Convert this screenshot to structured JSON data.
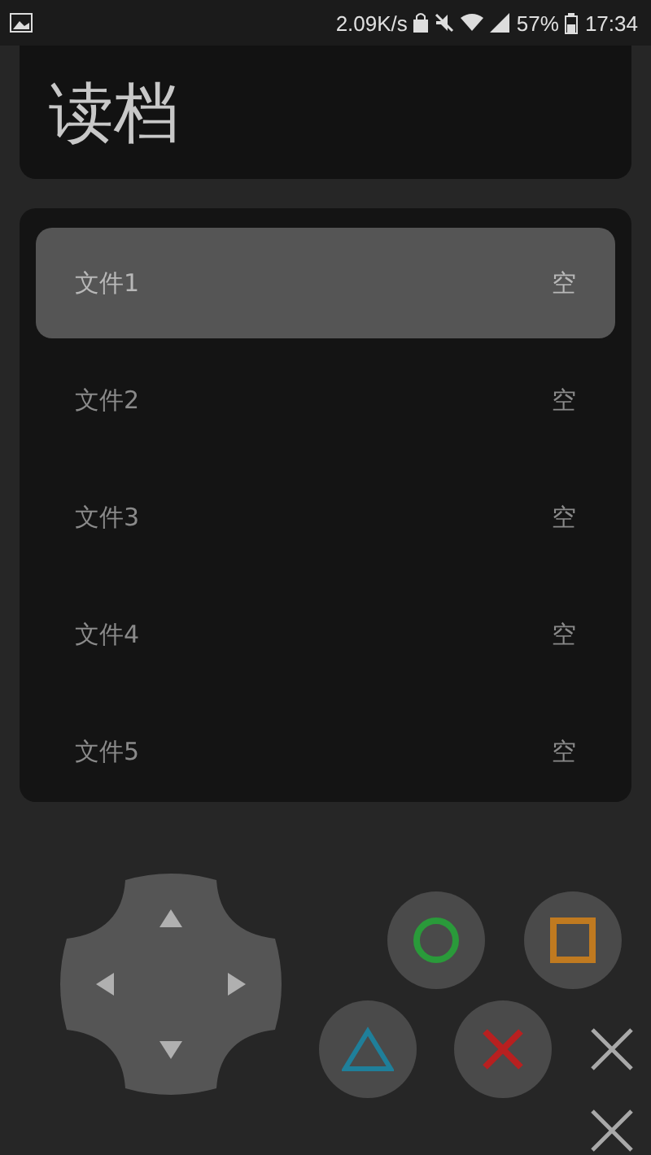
{
  "status_bar": {
    "network_speed": "2.09K/s",
    "battery_percent": "57%",
    "time": "17:34"
  },
  "title": "读档",
  "save_slots": [
    {
      "name": "文件1",
      "status": "空",
      "selected": true
    },
    {
      "name": "文件2",
      "status": "空",
      "selected": false
    },
    {
      "name": "文件3",
      "status": "空",
      "selected": false
    },
    {
      "name": "文件4",
      "status": "空",
      "selected": false
    },
    {
      "name": "文件5",
      "status": "空",
      "selected": false
    }
  ],
  "face_buttons": [
    {
      "kind": "circle",
      "color": "#2a9a3a"
    },
    {
      "kind": "square",
      "color": "#c07a20"
    },
    {
      "kind": "triangle",
      "color": "#1f7f9a"
    },
    {
      "kind": "cross",
      "color": "#b82020"
    }
  ]
}
